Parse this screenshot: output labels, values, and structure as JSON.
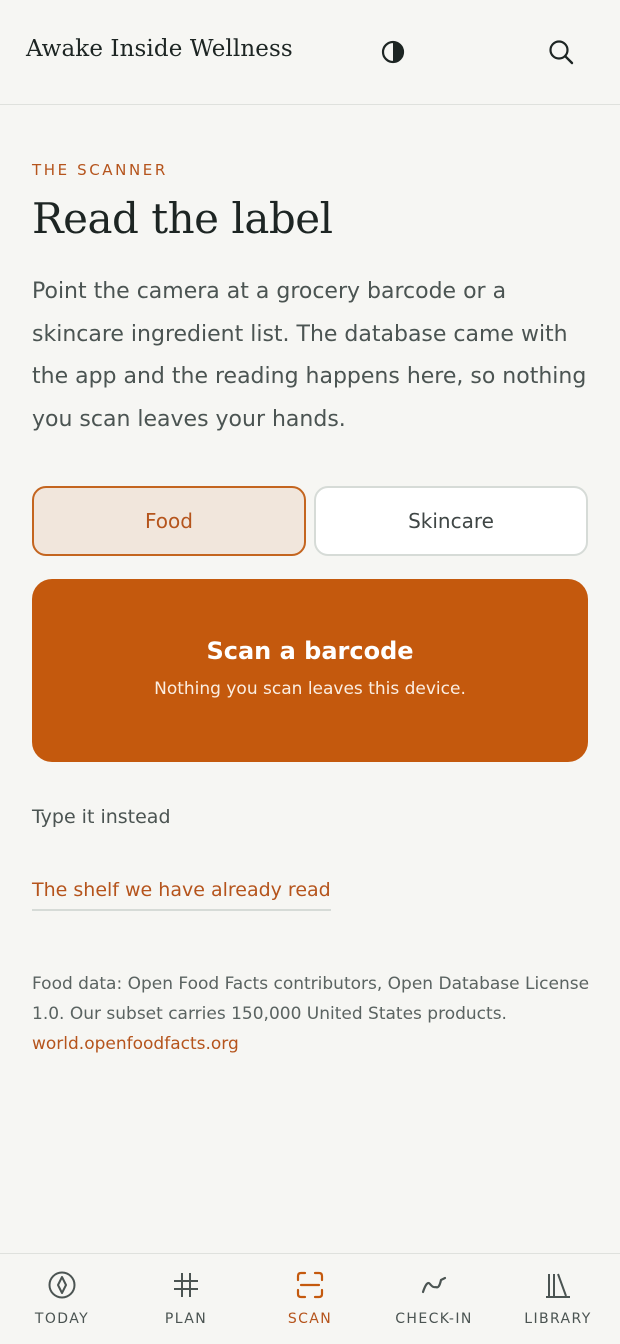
{
  "header": {
    "brand": "Awake Inside Wellness",
    "contrast_icon": "contrast-icon",
    "search_icon": "search-icon"
  },
  "main": {
    "eyebrow": "THE SCANNER",
    "title": "Read the label",
    "intro": "Point the camera at a grocery barcode or a skincare ingredient list. The database came with the app and the reading happens here, so nothing you scan leaves your hands.",
    "segments": [
      {
        "label": "Food",
        "selected": true
      },
      {
        "label": "Skincare",
        "selected": false
      }
    ],
    "scan_button": {
      "title": "Scan a barcode",
      "subtitle": "Nothing you scan leaves this device."
    },
    "type_instead": "Type it instead",
    "shelf_link": "The shelf we have already read",
    "attribution": "Food data: Open Food Facts contributors, Open Database License 1.0. Our subset carries 150,000 United States products.",
    "attribution_link": "world.openfoodfacts.org"
  },
  "tabbar": {
    "items": [
      {
        "label": "TODAY",
        "icon": "compass-icon",
        "active": false
      },
      {
        "label": "PLAN",
        "icon": "grid-icon",
        "active": false
      },
      {
        "label": "SCAN",
        "icon": "scan-icon",
        "active": true
      },
      {
        "label": "CHECK-IN",
        "icon": "pulse-icon",
        "active": false
      },
      {
        "label": "LIBRARY",
        "icon": "books-icon",
        "active": false
      }
    ]
  },
  "colors": {
    "accent": "#c4590d",
    "accent_text": "#b5541c",
    "background": "#f6f6f3"
  }
}
